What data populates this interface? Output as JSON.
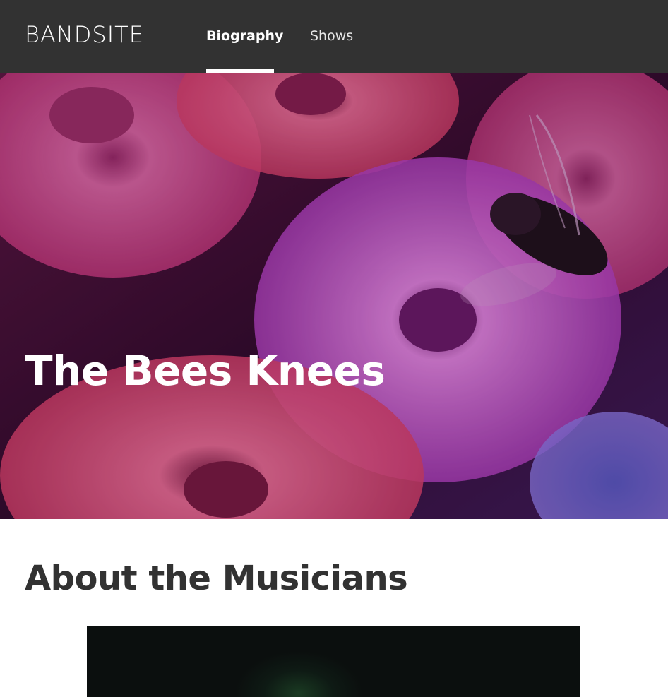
{
  "nav": {
    "logo": "BANDSITE",
    "links": [
      {
        "label": "Biography",
        "active": true
      },
      {
        "label": "Shows",
        "active": false
      }
    ]
  },
  "hero": {
    "title": "The Bees Knees"
  },
  "about": {
    "title": "About the Musicians"
  },
  "colors": {
    "nav_background": "#323232",
    "text_dark": "#323232",
    "hero_overlay": "#c0218a"
  }
}
